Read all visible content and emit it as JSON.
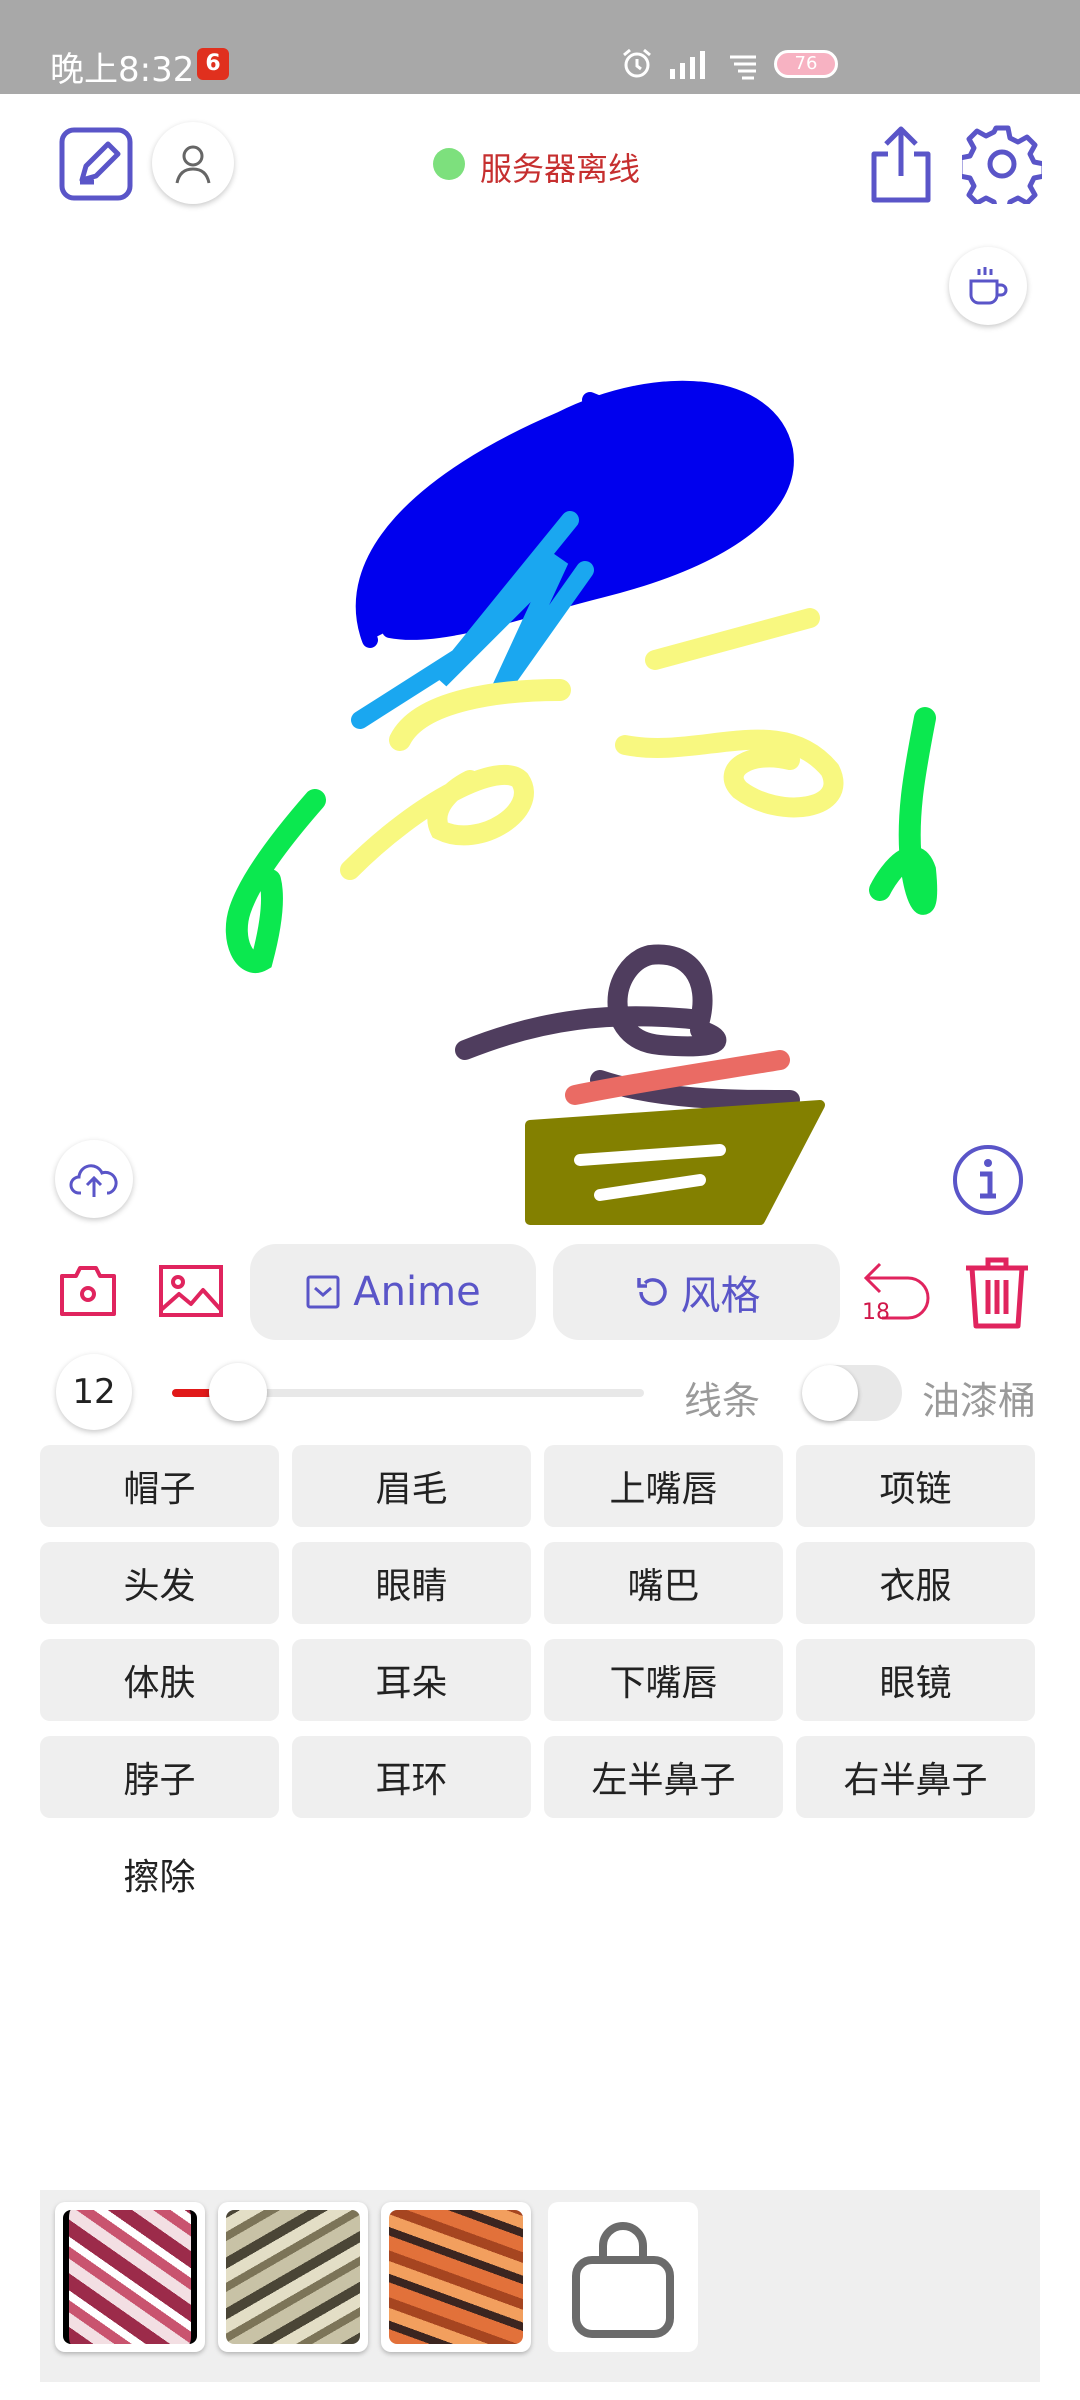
{
  "status_bar": {
    "time": "晚上8:32",
    "notification_badge": "6",
    "battery": "76"
  },
  "header": {
    "server_status": "服务器离线",
    "server_status_color": "#7de07d",
    "icons": [
      "edit-icon",
      "user-icon",
      "share-icon",
      "settings-icon"
    ]
  },
  "canvas_buttons": {
    "coffee": "coffee-icon",
    "upload": "cloud-upload-icon",
    "info": "info-icon"
  },
  "toolbar": {
    "camera": "camera-icon",
    "gallery": "image-icon",
    "model_label": "Anime",
    "style_label": "风格",
    "undo_count": "18",
    "delete": "trash-icon",
    "accent": "#e0245e",
    "brand": "#5a55c8"
  },
  "brush": {
    "size": "12",
    "slider_fraction": 0.14,
    "line_label": "线条",
    "bucket_label": "油漆桶",
    "bucket_enabled": false,
    "stroke_color": "#e11919"
  },
  "tags": [
    [
      "帽子",
      "眉毛",
      "上嘴唇",
      "项链"
    ],
    [
      "头发",
      "眼睛",
      "嘴巴",
      "衣服"
    ],
    [
      "体肤",
      "耳朵",
      "下嘴唇",
      "眼镜"
    ],
    [
      "脖子",
      "耳环",
      "左半鼻子",
      "右半鼻子"
    ]
  ],
  "erase_label": "擦除",
  "style_thumbnails": [
    "style-thumbnail-1",
    "style-thumbnail-2",
    "style-thumbnail-3",
    "shop-bag-icon"
  ]
}
